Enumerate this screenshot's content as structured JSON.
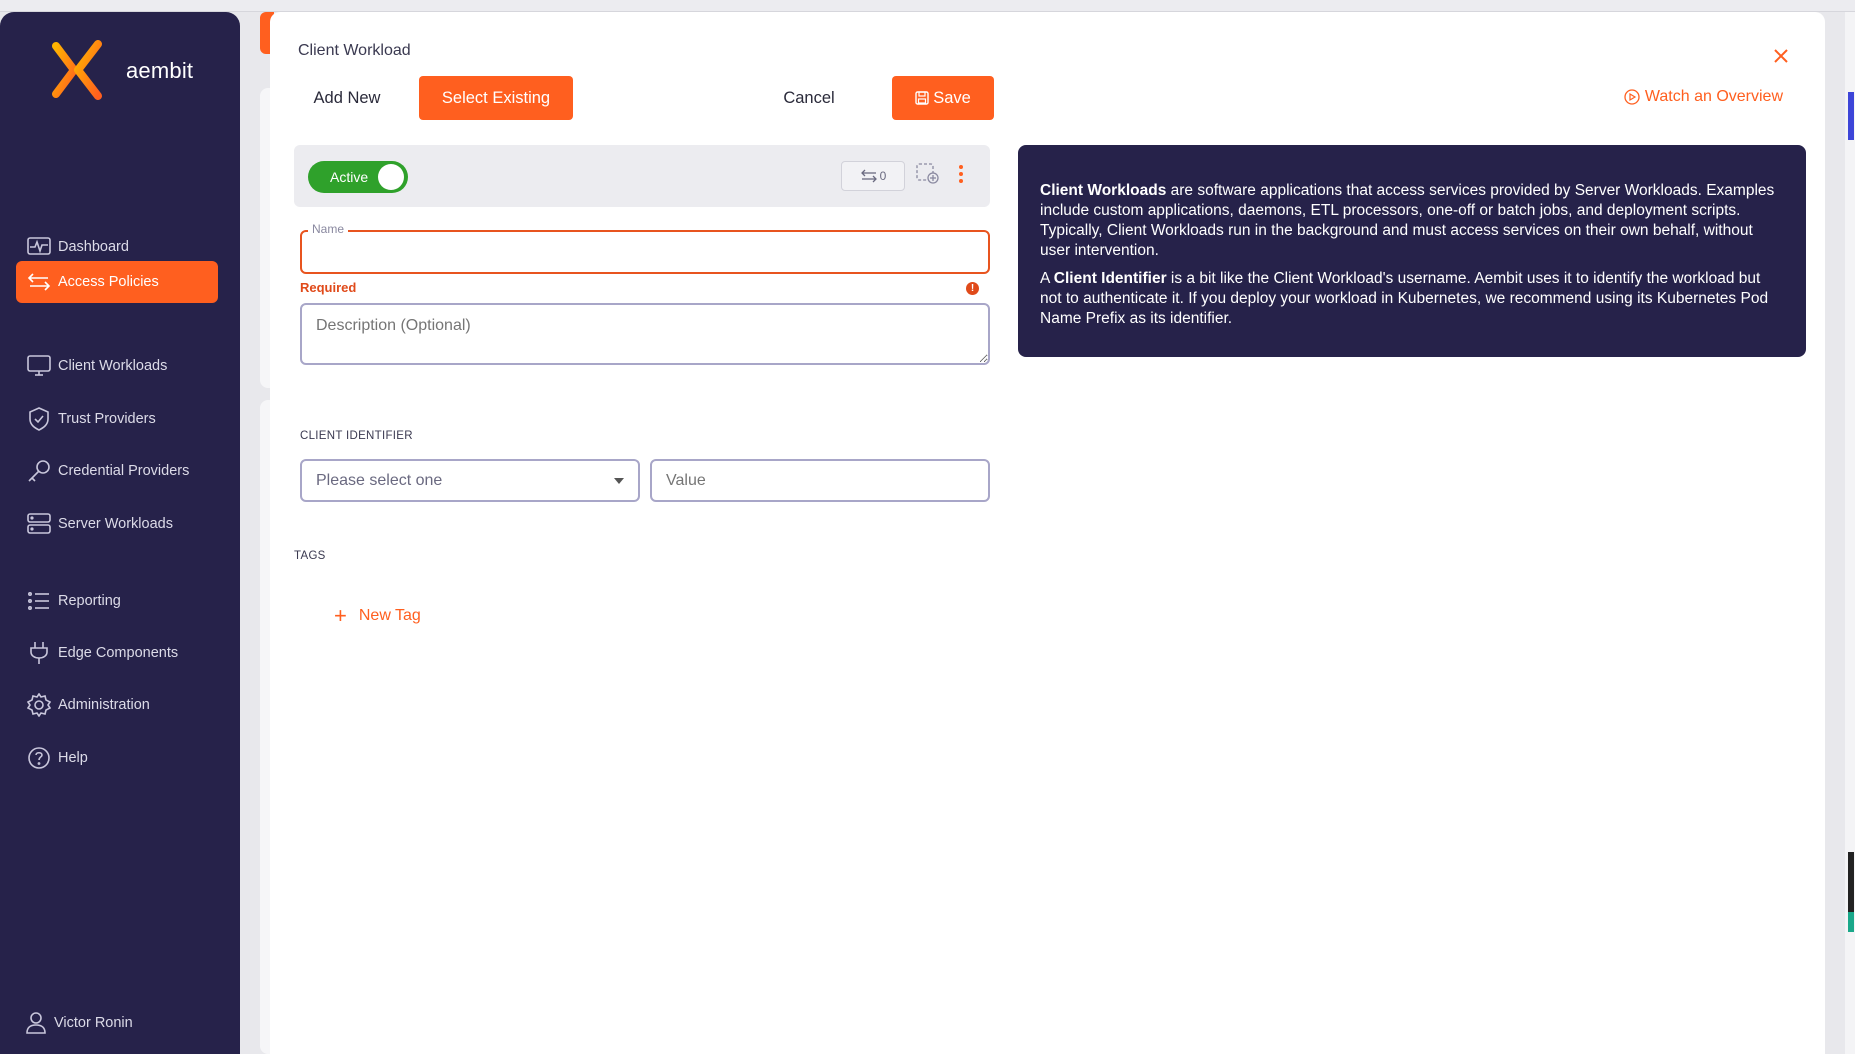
{
  "brand": {
    "name": "aembit",
    "accent": "#ff5f1f",
    "sidebar_bg": "#26224a"
  },
  "sidebar": {
    "items": [
      {
        "label": "Dashboard",
        "icon": "pulse-icon",
        "active": false
      },
      {
        "label": "Access Policies",
        "icon": "swap-arrows-icon",
        "active": true
      },
      {
        "label": "Client Workloads",
        "icon": "monitor-icon",
        "active": false
      },
      {
        "label": "Trust Providers",
        "icon": "shield-check-icon",
        "active": false
      },
      {
        "label": "Credential Providers",
        "icon": "key-icon",
        "active": false
      },
      {
        "label": "Server Workloads",
        "icon": "server-icon",
        "active": false
      },
      {
        "label": "Reporting",
        "icon": "list-icon",
        "active": false
      },
      {
        "label": "Edge Components",
        "icon": "plug-icon",
        "active": false
      },
      {
        "label": "Administration",
        "icon": "gear-icon",
        "active": false
      },
      {
        "label": "Help",
        "icon": "help-circle-icon",
        "active": false
      }
    ],
    "user": "Victor Ronin"
  },
  "modal": {
    "title": "Client Workload",
    "add_new": "Add New",
    "select_existing": "Select Existing",
    "cancel": "Cancel",
    "save": "Save",
    "watch_overview": "Watch an Overview",
    "status": {
      "toggle_label": "Active",
      "count": "0"
    },
    "name": {
      "label": "Name",
      "value": "",
      "error": "Required",
      "error_icon": "!"
    },
    "description": {
      "placeholder": "Description (Optional)"
    },
    "client_identifier": {
      "section_label": "CLIENT IDENTIFIER",
      "select_placeholder": "Please select one",
      "value_placeholder": "Value"
    },
    "tags": {
      "section_label": "TAGS",
      "new_tag": "New Tag",
      "plus": "+"
    }
  },
  "info": {
    "p1_bold": "Client Workloads",
    "p1_text": " are software applications that access services provided by Server Workloads. Examples include custom applications, daemons, ETL processors, one-off or batch jobs, and deployment scripts. Typically, Client Workloads run in the background and must access services on their own behalf, without user intervention.",
    "p2_pre": "A ",
    "p2_bold": "Client Identifier",
    "p2_text": " is a bit like the Client Workload's username. Aembit uses it to identify the workload but not to authenticate it. If you deploy your workload in Kubernetes, we recommend using its Kubernetes Pod Name Prefix as its identifier."
  }
}
